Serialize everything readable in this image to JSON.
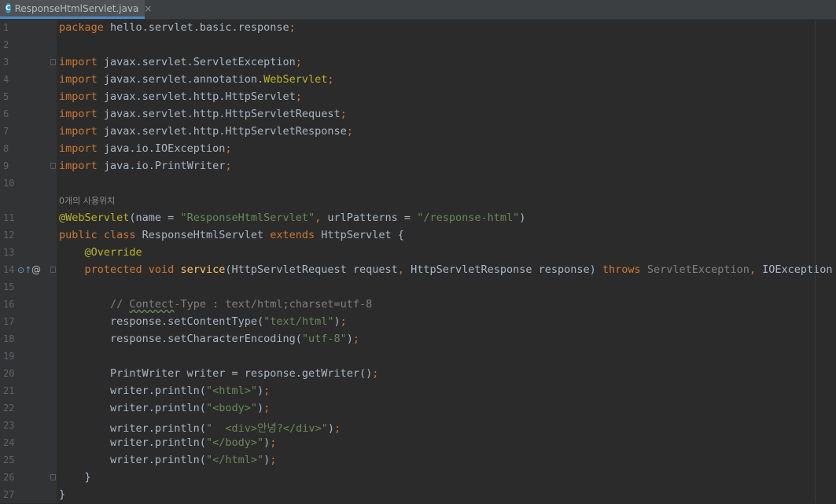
{
  "tab": {
    "icon_letter": "C",
    "filename": "ResponseHtmlServlet.java",
    "close_glyph": "×"
  },
  "usage_hint": "0개의 사용위치",
  "code_lines": [
    {
      "ln": "1",
      "text": "package hello.servlet.basic.response;"
    },
    {
      "ln": "2",
      "text": ""
    },
    {
      "ln": "3",
      "text": "import javax.servlet.ServletException;"
    },
    {
      "ln": "4",
      "text": "import javax.servlet.annotation.WebServlet;"
    },
    {
      "ln": "5",
      "text": "import javax.servlet.http.HttpServlet;"
    },
    {
      "ln": "6",
      "text": "import javax.servlet.http.HttpServletRequest;"
    },
    {
      "ln": "7",
      "text": "import javax.servlet.http.HttpServletResponse;"
    },
    {
      "ln": "8",
      "text": "import java.io.IOException;"
    },
    {
      "ln": "9",
      "text": "import java.io.PrintWriter;"
    },
    {
      "ln": "10",
      "text": ""
    },
    {
      "ln": "11",
      "text": "@WebServlet(name = \"ResponseHtmlServlet\", urlPatterns = \"/response-html\")"
    },
    {
      "ln": "12",
      "text": "public class ResponseHtmlServlet extends HttpServlet {"
    },
    {
      "ln": "13",
      "text": "    @Override"
    },
    {
      "ln": "14",
      "text": "    protected void service(HttpServletRequest request, HttpServletResponse response) throws ServletException, IOException {"
    },
    {
      "ln": "15",
      "text": ""
    },
    {
      "ln": "16",
      "text": "        // Contect-Type : text/html;charset=utf-8"
    },
    {
      "ln": "17",
      "text": "        response.setContentType(\"text/html\");"
    },
    {
      "ln": "18",
      "text": "        response.setCharacterEncoding(\"utf-8\");"
    },
    {
      "ln": "19",
      "text": ""
    },
    {
      "ln": "20",
      "text": "        PrintWriter writer = response.getWriter();"
    },
    {
      "ln": "21",
      "text": "        writer.println(\"<html>\");"
    },
    {
      "ln": "22",
      "text": "        writer.println(\"<body>\");"
    },
    {
      "ln": "23",
      "text": "        writer.println(\"  <div>안녕?</div>\");"
    },
    {
      "ln": "24",
      "text": "        writer.println(\"</body>\");"
    },
    {
      "ln": "25",
      "text": "        writer.println(\"</html>\");"
    },
    {
      "ln": "26",
      "text": "    }"
    },
    {
      "ln": "27",
      "text": "}"
    }
  ],
  "gutter_icons": {
    "line14": [
      "override-method-icon",
      "annotation-at-icon"
    ]
  },
  "colors": {
    "background": "#2b2b2b",
    "gutter": "#313335",
    "keyword": "#cc7832",
    "string": "#6a8759",
    "annotation": "#bbb529",
    "method": "#ffc66d",
    "comment": "#808080",
    "text": "#a9b7c6"
  }
}
